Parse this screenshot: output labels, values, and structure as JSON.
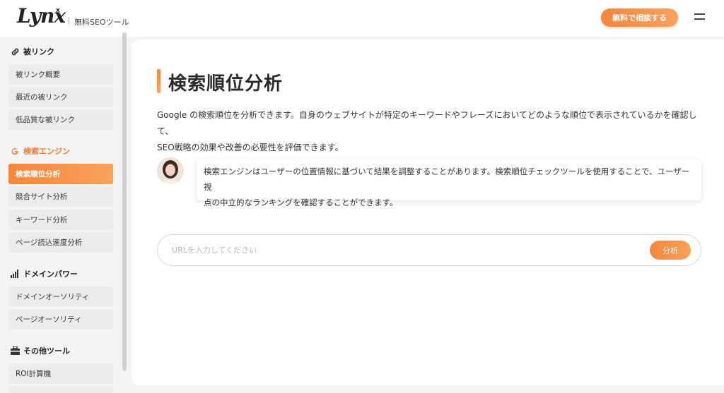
{
  "header": {
    "logo": "Lynx",
    "logo_sup": "x",
    "tagline": "無料SEOツール",
    "cta_label": "無料で相談する"
  },
  "sidebar": {
    "sections": [
      {
        "title": "被リンク",
        "icon": "link-icon",
        "items": [
          "被リンク概要",
          "最近の被リンク",
          "低品質な被リンク"
        ]
      },
      {
        "title": "検索エンジン",
        "icon": "google-g-icon",
        "items": [
          "検索順位分析",
          "競合サイト分析",
          "キーワード分析",
          "ページ読込速度分析"
        ]
      },
      {
        "title": "ドメインパワー",
        "icon": "signal-bars-icon",
        "items": [
          "ドメインオーソリティ",
          "ページオーソリティ"
        ]
      },
      {
        "title": "その他ツール",
        "icon": "toolbox-icon",
        "items": [
          "ROI計算機"
        ]
      }
    ],
    "active_item": "検索順位分析"
  },
  "main": {
    "title": "検索順位分析",
    "description_line1": "Google の検索順位を分析できます。自身のウェブサイトが特定のキーワードやフレーズにおいてどのような順位で表示されているかを確認して、",
    "description_line2": "SEO戦略の効果や改善の必要性を評価できます。",
    "tip_line1": "検索エンジンはユーザーの位置情報に基づいて結果を調整することがあります。検索順位チェックツールを使用することで、ユーザー視",
    "tip_line2": "点の中立的なランキングを確認することができます。",
    "url_placeholder": "URLを入力してください",
    "analyze_label": "分析"
  },
  "colors": {
    "accent": "#f5863c",
    "accent_light": "#f9a25c",
    "nav_bg": "#ececec"
  }
}
